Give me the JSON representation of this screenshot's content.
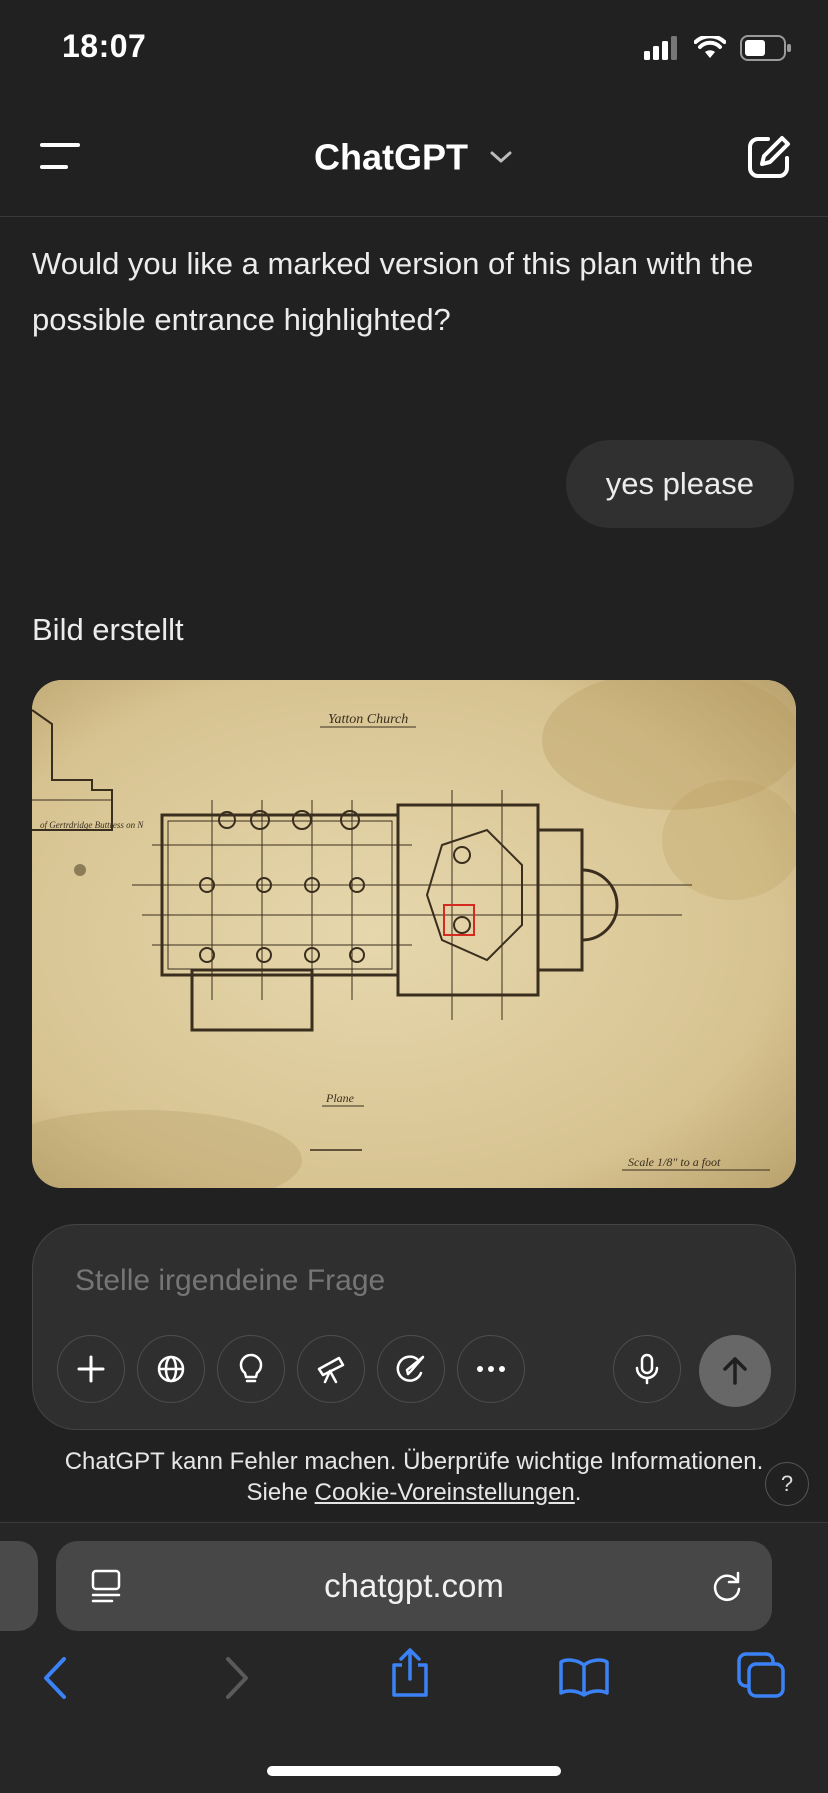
{
  "status_bar": {
    "time": "18:07"
  },
  "header": {
    "title": "ChatGPT"
  },
  "messages": {
    "assistant_text": "Would you like a marked version of this plan with the possible entrance highlighted?",
    "user_text": "yes please",
    "image_caption": "Bild erstellt",
    "image": {
      "title": "Yatton Church",
      "label_left": "of Gertrdridge Buttress on N",
      "plan_label": "Plane",
      "scale_label": "Scale 1/8\" to a foot"
    }
  },
  "composer": {
    "placeholder": "Stelle irgendeine Frage"
  },
  "disclaimer": {
    "line1": "ChatGPT kann Fehler machen. Überprüfe wichtige Informationen.",
    "line2_prefix": "Siehe ",
    "link": "Cookie-Voreinstellungen",
    "line2_suffix": "."
  },
  "help_label": "?",
  "browser": {
    "url": "chatgpt.com"
  },
  "colors": {
    "accent_blue": "#3b82f6",
    "background": "#212121",
    "highlight_box": "#d42a1f"
  }
}
